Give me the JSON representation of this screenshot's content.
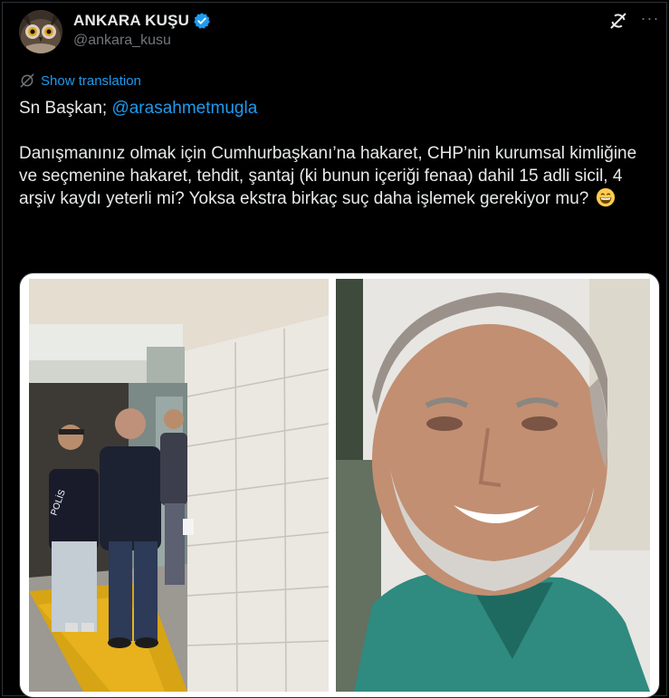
{
  "author": {
    "display_name": "ANKARA KUŞU",
    "handle": "@ankara_kusu",
    "verified": true,
    "verified_color": "#1d9bf0"
  },
  "header_actions": {
    "grok_icon": "grok-slash-icon",
    "more_icon": "more-dots-icon",
    "more_label": "···"
  },
  "translation": {
    "label": "Show translation",
    "icon": "globe-slash-icon"
  },
  "tweet": {
    "greeting": "Sn Başkan;",
    "mention": "@arasahmetmugla",
    "body": "Danışmanınız olmak için Cumhurbaşkanı’na hakaret, CHP’nin kurumsal kimliğine ve seçmenine hakaret, tehdit, şantaj (ki bunun içeriği fenaa) dahil 15 adli sicil, 4 arşiv kaydı yeterli mi? Yoksa ekstra birkaç suç daha işlemek gerekiyor mu?",
    "emoji": "grinning-face-emoji",
    "police_vest_text": "POLİS"
  },
  "colors": {
    "background": "#000000",
    "text": "#e7e9ea",
    "secondary": "#71767b",
    "link": "#1d9bf0",
    "border": "#2f3336"
  }
}
